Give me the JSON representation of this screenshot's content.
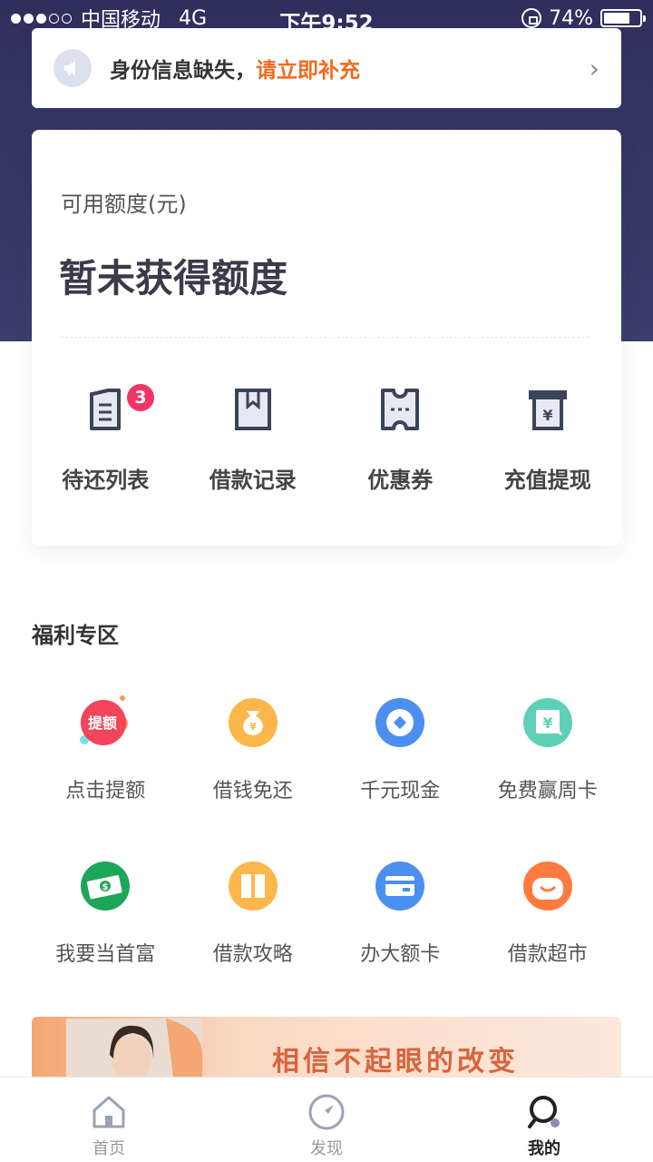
{
  "status": {
    "carrier": "中国移动",
    "network": "4G",
    "time": "下午9:52",
    "battery": "74%",
    "battery_level": 0.74
  },
  "notice": {
    "text": "身份信息缺失，",
    "highlight": "请立即补充",
    "highlight_color": "#f06a1d"
  },
  "credit": {
    "label": "可用额度(元)",
    "value": "暂未获得额度"
  },
  "quick_actions": [
    {
      "label": "待还列表",
      "icon": "repay-list-icon",
      "badge": "3"
    },
    {
      "label": "借款记录",
      "icon": "loan-record-icon"
    },
    {
      "label": "优惠券",
      "icon": "coupon-icon"
    },
    {
      "label": "充值提现",
      "icon": "recharge-withdraw-icon"
    }
  ],
  "welfare": {
    "title": "福利专区",
    "items": [
      {
        "label": "点击提额",
        "icon": "raise-limit-icon",
        "icon_text": "提额"
      },
      {
        "label": "借钱免还",
        "icon": "money-bag-icon"
      },
      {
        "label": "千元现金",
        "icon": "cash-icon"
      },
      {
        "label": "免费赢周卡",
        "icon": "weekly-card-icon"
      },
      {
        "label": "我要当首富",
        "icon": "banknote-icon"
      },
      {
        "label": "借款攻略",
        "icon": "guide-book-icon"
      },
      {
        "label": "办大额卡",
        "icon": "credit-card-icon"
      },
      {
        "label": "借款超市",
        "icon": "loan-market-icon"
      }
    ]
  },
  "banner": {
    "text": "相信不起眼的改变"
  },
  "tabs": [
    {
      "label": "首页",
      "icon": "home-icon",
      "active": false
    },
    {
      "label": "发现",
      "icon": "discover-icon",
      "active": false
    },
    {
      "label": "我的",
      "icon": "profile-icon",
      "active": true
    }
  ],
  "colors": {
    "hero": "#2e2f5c",
    "badge": "#f43466",
    "accent": "#f06a1d"
  }
}
